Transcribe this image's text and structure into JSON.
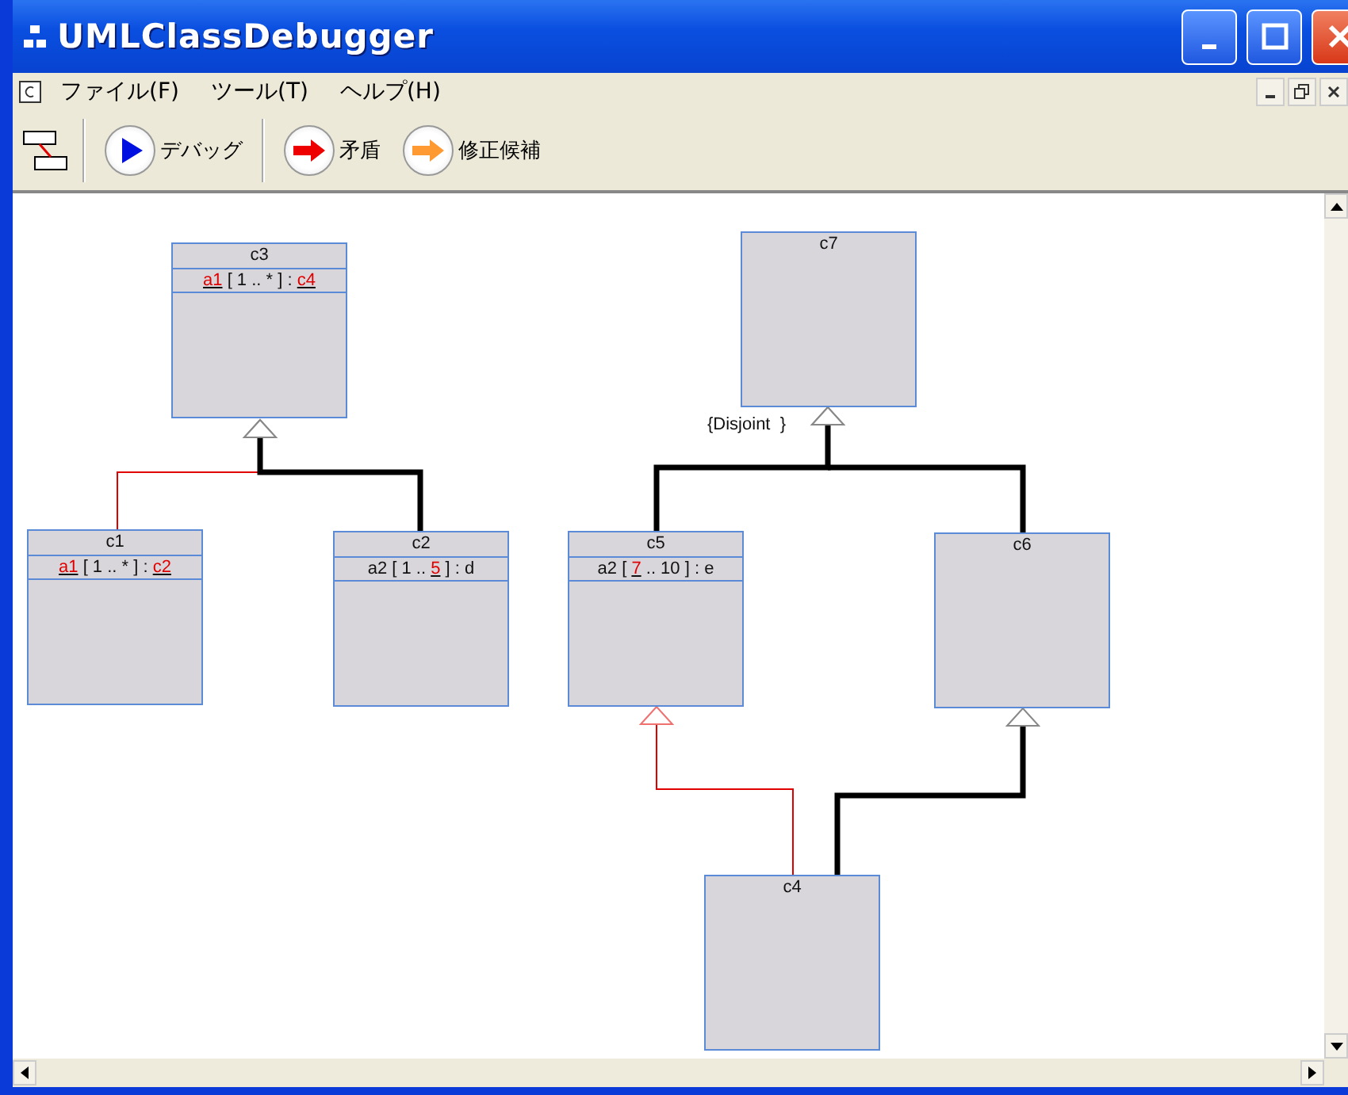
{
  "window": {
    "title": "UMLClassDebugger"
  },
  "menu": [
    {
      "label": "ファイル(F)"
    },
    {
      "label": "ツール(T)"
    },
    {
      "label": "ヘルプ(H)"
    }
  ],
  "toolbar": [
    {
      "label": "デバッグ",
      "kind": "play",
      "color": "#0010e0"
    },
    {
      "label": "矛盾",
      "kind": "arrow",
      "color": "#ee0000"
    },
    {
      "label": "修正候補",
      "kind": "arrow",
      "color": "#ff9a33"
    }
  ],
  "classes": [
    {
      "name": "c3",
      "attributes": [
        [
          {
            "text": "a1",
            "error": true
          },
          {
            "text": " [ 1 .. * ] : ",
            "error": false
          },
          {
            "text": "c4",
            "error": true
          }
        ]
      ]
    },
    {
      "name": "c1",
      "attributes": [
        [
          {
            "text": "a1",
            "error": true
          },
          {
            "text": " [ 1 .. * ] : ",
            "error": false
          },
          {
            "text": "c2",
            "error": true
          }
        ]
      ]
    },
    {
      "name": "c2",
      "attributes": [
        [
          {
            "text": "a2 [ 1 .. ",
            "error": false
          },
          {
            "text": "5",
            "error": true
          },
          {
            "text": " ] : d",
            "error": false
          }
        ]
      ]
    },
    {
      "name": "c7",
      "constraint": "{Disjoint  }"
    },
    {
      "name": "c5",
      "attributes": [
        [
          {
            "text": "a2 [ ",
            "error": false
          },
          {
            "text": "7",
            "error": true
          },
          {
            "text": " .. 10 ] : e",
            "error": false
          }
        ]
      ]
    },
    {
      "name": "c6"
    },
    {
      "name": "c4"
    }
  ],
  "generalizations": [
    {
      "kind": "error"
    },
    {
      "kind": "normal"
    },
    {
      "kind": "normal"
    },
    {
      "kind": "normal"
    },
    {
      "kind": "error"
    },
    {
      "kind": "normal"
    }
  ]
}
